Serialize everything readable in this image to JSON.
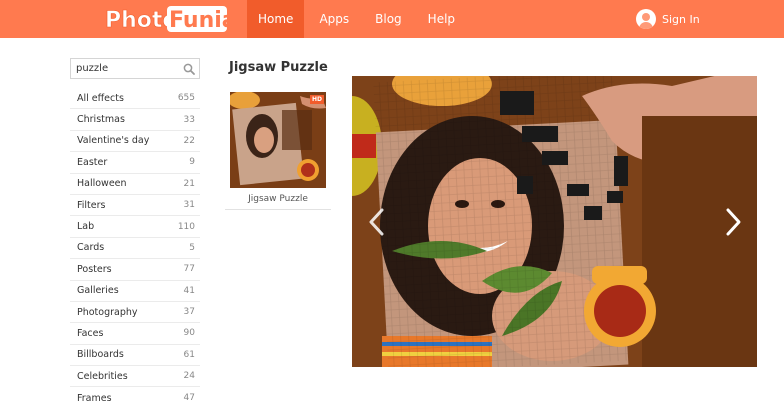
{
  "header": {
    "logo_text_1": "Photo",
    "logo_text_2": "Funia",
    "nav": [
      {
        "label": "Home",
        "active": true
      },
      {
        "label": "Apps",
        "active": false
      },
      {
        "label": "Blog",
        "active": false
      },
      {
        "label": "Help",
        "active": false
      }
    ],
    "signin_label": "Sign In",
    "brand_color": "#ff7a4f",
    "active_color": "#f15c2b"
  },
  "search": {
    "value": "puzzle",
    "icon": "search-icon"
  },
  "categories": [
    {
      "label": "All effects",
      "count": "655"
    },
    {
      "label": "Christmas",
      "count": "33"
    },
    {
      "label": "Valentine's day",
      "count": "22"
    },
    {
      "label": "Easter",
      "count": "9"
    },
    {
      "label": "Halloween",
      "count": "21"
    },
    {
      "label": "Filters",
      "count": "31"
    },
    {
      "label": "Lab",
      "count": "110"
    },
    {
      "label": "Cards",
      "count": "5"
    },
    {
      "label": "Posters",
      "count": "77"
    },
    {
      "label": "Galleries",
      "count": "41"
    },
    {
      "label": "Photography",
      "count": "37"
    },
    {
      "label": "Faces",
      "count": "90"
    },
    {
      "label": "Billboards",
      "count": "61"
    },
    {
      "label": "Celebrities",
      "count": "24"
    },
    {
      "label": "Frames",
      "count": "47"
    }
  ],
  "effect": {
    "title": "Jigsaw Puzzle",
    "thumb_label": "Jigsaw Puzzle",
    "hd_badge": "HD"
  },
  "carousel": {
    "prev_icon": "chevron-left-icon",
    "next_icon": "chevron-right-icon"
  }
}
